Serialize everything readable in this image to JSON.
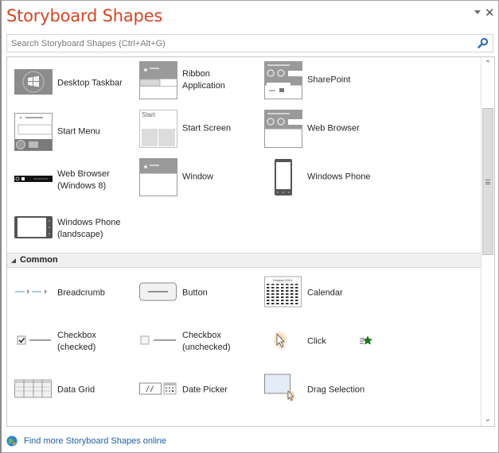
{
  "pane": {
    "title": "Storyboard Shapes",
    "menu_icon": "dropdown-triangle-icon",
    "close_label": "✕"
  },
  "search": {
    "value": "",
    "placeholder": "Search Storyboard Shapes (Ctrl+Alt+G)",
    "icon": "search-icon"
  },
  "shapes_top": [
    {
      "label": "Desktop Taskbar",
      "icon": "desktop-taskbar-icon"
    },
    {
      "label": "Ribbon\nApplication",
      "icon": "ribbon-application-icon"
    },
    {
      "label": "SharePoint",
      "icon": "sharepoint-icon"
    },
    {
      "label": "Start Menu",
      "icon": "start-menu-icon"
    },
    {
      "label": "Start Screen",
      "icon": "start-screen-icon"
    },
    {
      "label": "Web Browser",
      "icon": "web-browser-icon"
    },
    {
      "label": "Web Browser\n(Windows 8)",
      "icon": "web-browser-windows8-icon"
    },
    {
      "label": "Window",
      "icon": "window-icon"
    },
    {
      "label": "Windows Phone",
      "icon": "windows-phone-icon"
    },
    {
      "label": "Windows Phone\n(landscape)",
      "icon": "windows-phone-landscape-icon"
    }
  ],
  "group": {
    "label": "Common",
    "expanded": true
  },
  "shapes_common": [
    {
      "label": "Breadcrumb",
      "icon": "breadcrumb-icon"
    },
    {
      "label": "Button",
      "icon": "button-icon"
    },
    {
      "label": "Calendar",
      "icon": "calendar-icon"
    },
    {
      "label": "Checkbox\n(checked)",
      "icon": "checkbox-checked-icon"
    },
    {
      "label": "Checkbox\n(unchecked)",
      "icon": "checkbox-unchecked-icon"
    },
    {
      "label": "Click",
      "icon": "click-icon",
      "badge_icon": "animation-star-icon"
    },
    {
      "label": "Data Grid",
      "icon": "data-grid-icon"
    },
    {
      "label": "Date Picker",
      "icon": "date-picker-icon",
      "date_text": "/ /"
    },
    {
      "label": "Drag Selection",
      "icon": "drag-selection-icon"
    }
  ],
  "icon_text": {
    "start_screen": "Start",
    "calendar_month": "October 2013"
  },
  "scrollbar": {
    "position_fraction": 0.11,
    "visible_fraction": 0.43
  },
  "footer": {
    "link_label": "Find more Storyboard Shapes online",
    "icon": "globe-icon"
  },
  "colors": {
    "title": "#d24726",
    "link": "#1e5fa6",
    "group_bg": "#f0f0f0"
  }
}
